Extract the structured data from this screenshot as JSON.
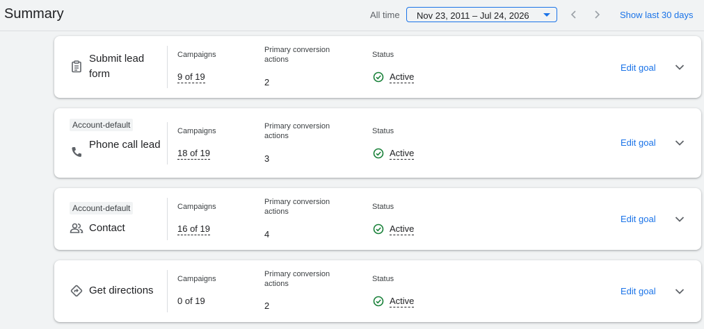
{
  "header": {
    "title": "Summary",
    "range_label": "All time",
    "date_range": "Nov 23, 2011 – Jul 24, 2026",
    "show_last": "Show last 30 days"
  },
  "labels": {
    "campaigns": "Campaigns",
    "primary_line1": "Primary conversion",
    "primary_line2": "actions",
    "status": "Status",
    "edit": "Edit goal"
  },
  "goals": [
    {
      "name": "Submit lead form",
      "badge": "",
      "icon": "clipboard-icon",
      "campaigns": "9 of 19",
      "primary": "2",
      "status": "Active"
    },
    {
      "name": "Phone call lead",
      "badge": "Account-default",
      "icon": "phone-icon",
      "campaigns": "18 of 19",
      "primary": "3",
      "status": "Active"
    },
    {
      "name": "Contact",
      "badge": "Account-default",
      "icon": "people-icon",
      "campaigns": "16 of 19",
      "primary": "4",
      "status": "Active"
    },
    {
      "name": "Get directions",
      "badge": "",
      "icon": "directions-icon",
      "campaigns": "0 of 19",
      "primary": "2",
      "status": "Active"
    }
  ],
  "colors": {
    "accent": "#1a73e8",
    "active": "#188038",
    "muted": "#5f6368"
  }
}
